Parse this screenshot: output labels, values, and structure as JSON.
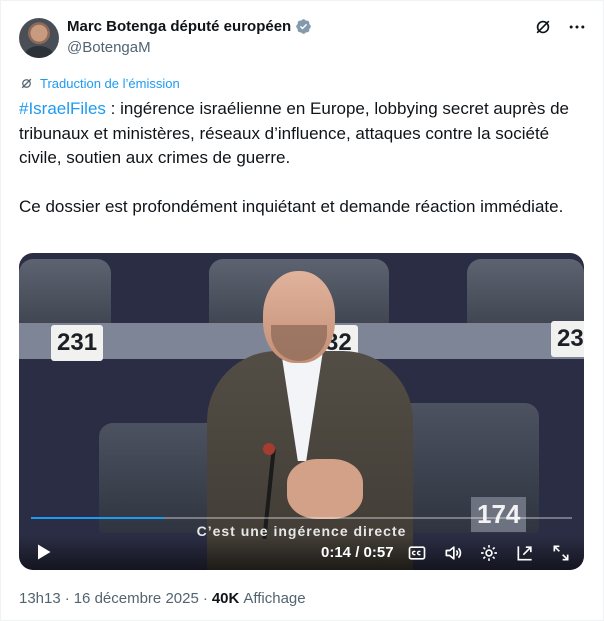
{
  "author": {
    "display_name": "Marc Botenga député européen",
    "handle": "@BotengaM",
    "verified_icon": "verified-badge-icon",
    "avatar": "profile-photo"
  },
  "top_actions": [
    {
      "name": "grok-icon"
    },
    {
      "name": "more-options-icon",
      "label": "···"
    }
  ],
  "translation": {
    "icon": "translate-icon",
    "label": "Traduction de l’émission"
  },
  "post": {
    "hashtag": "#IsraelFiles",
    "paragraph1_rest": " : ingérence israélienne en Europe, lobbying secret auprès de tribunaux et ministères, réseaux d’influence, attaques contre la société civile, soutien aux crimes de guerre.",
    "paragraph2": "Ce dossier est profondément inquiétant et demande réaction immédiate."
  },
  "video": {
    "seat_labels": [
      "231",
      "32",
      "23",
      "174"
    ],
    "subtitle": "C’est une ingérence directe",
    "time": "0:14 / 0:57",
    "progress": 0.245,
    "controls": [
      {
        "name": "play-icon"
      },
      {
        "name": "captions-icon"
      },
      {
        "name": "volume-icon"
      },
      {
        "name": "settings-icon"
      },
      {
        "name": "picture-in-picture-icon"
      },
      {
        "name": "fullscreen-icon"
      }
    ],
    "accent": "#1d9bf0"
  },
  "meta": {
    "time": "13h13",
    "separator": "·",
    "date": "16 décembre 2025",
    "views": "40K",
    "views_label": "Affichage"
  }
}
